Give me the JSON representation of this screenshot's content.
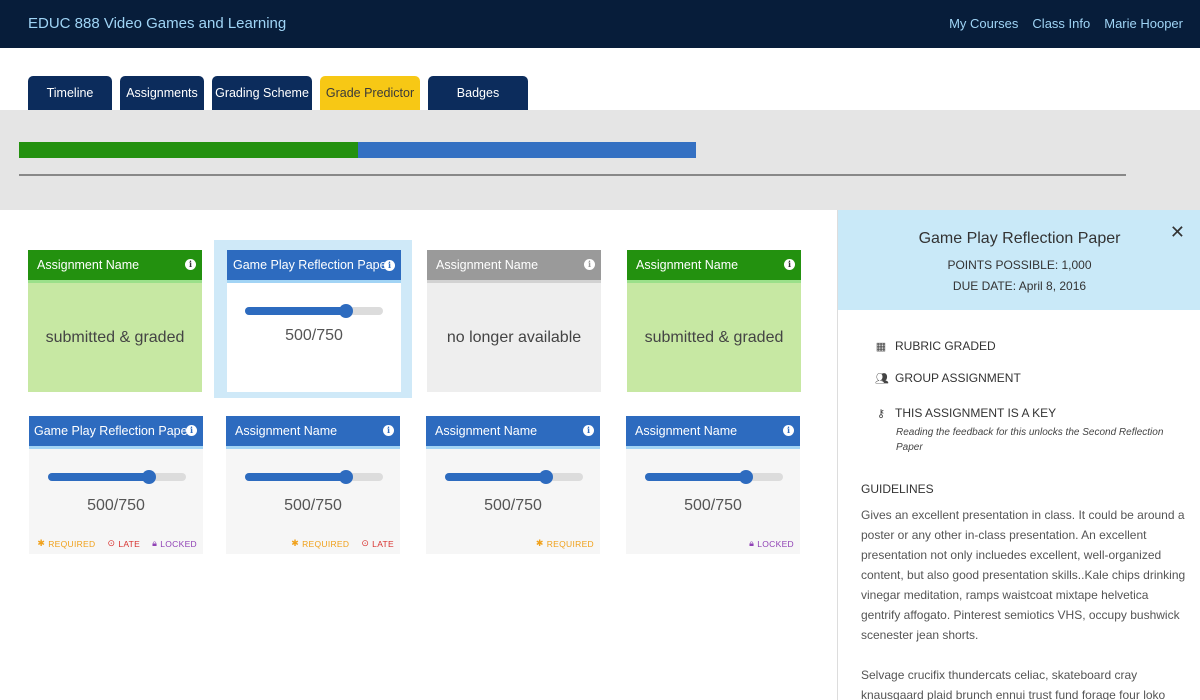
{
  "header": {
    "title": "EDUC 888 Video Games and Learning",
    "nav": [
      "My Courses",
      "Class Info",
      "Marie Hooper"
    ]
  },
  "tabs": [
    {
      "label": "Timeline",
      "active": false
    },
    {
      "label": "Assignments",
      "active": false
    },
    {
      "label": "Grading Scheme",
      "active": false
    },
    {
      "label": "Grade Predictor",
      "active": true
    },
    {
      "label": "Badges",
      "active": false
    }
  ],
  "progress": {
    "earned_fraction": 0.306,
    "predicted_fraction": 0.306,
    "earned_color": "#23910f",
    "predicted_color": "#3470c2"
  },
  "cards_row1": [
    {
      "title": "Assignment Name",
      "state": "graded",
      "status_text": "submitted & graded"
    },
    {
      "title": "Game Play Reflection Paper",
      "state": "selected",
      "score": "500/750",
      "slider_fraction": 0.73
    },
    {
      "title": "Assignment Name",
      "state": "unavailable",
      "status_text": "no longer available"
    },
    {
      "title": "Assignment Name",
      "state": "graded",
      "status_text": "submitted & graded"
    }
  ],
  "cards_row2": [
    {
      "title": "Game Play Reflection Paper",
      "score": "500/750",
      "slider_fraction": 0.73,
      "flags": [
        "REQUIRED",
        "LATE",
        "LOCKED"
      ]
    },
    {
      "title": "Assignment Name",
      "score": "500/750",
      "slider_fraction": 0.73,
      "flags": [
        "REQUIRED",
        "LATE"
      ]
    },
    {
      "title": "Assignment Name",
      "score": "500/750",
      "slider_fraction": 0.73,
      "flags": [
        "REQUIRED"
      ]
    },
    {
      "title": "Assignment Name",
      "score": "500/750",
      "slider_fraction": 0.73,
      "flags": [
        "LOCKED"
      ]
    }
  ],
  "panel": {
    "title": "Game Play Reflection Paper",
    "points_label": "POINTS POSSIBLE:",
    "points_value": "1,000",
    "due_label": "DUE DATE:",
    "due_value": "April 8, 2016",
    "properties": [
      {
        "icon": "grid-icon",
        "label": "RUBRIC GRADED"
      },
      {
        "icon": "group-icon",
        "label": "GROUP ASSIGNMENT"
      },
      {
        "icon": "key-icon",
        "label": "THIS ASSIGNMENT IS A KEY"
      }
    ],
    "key_note": "Reading the feedback for this unlocks the Second Reflection Paper",
    "guidelines_title": "GUIDELINES",
    "guidelines_p1": "Gives an excellent presentation in class. It could be around a poster or any other in-class presentation. An excellent presentation not only incluedes excellent, well-organized content, but also good presentation skills..Kale chips drinking vinegar meditation, ramps waistcoat mixtape helvetica gentrify affogato. Pinterest semiotics VHS, occupy bushwick scenester jean shorts.",
    "guidelines_p2": "Selvage crucifix thundercats celiac, skateboard cray knausgaard plaid brunch ennui trust fund forage four loko"
  }
}
